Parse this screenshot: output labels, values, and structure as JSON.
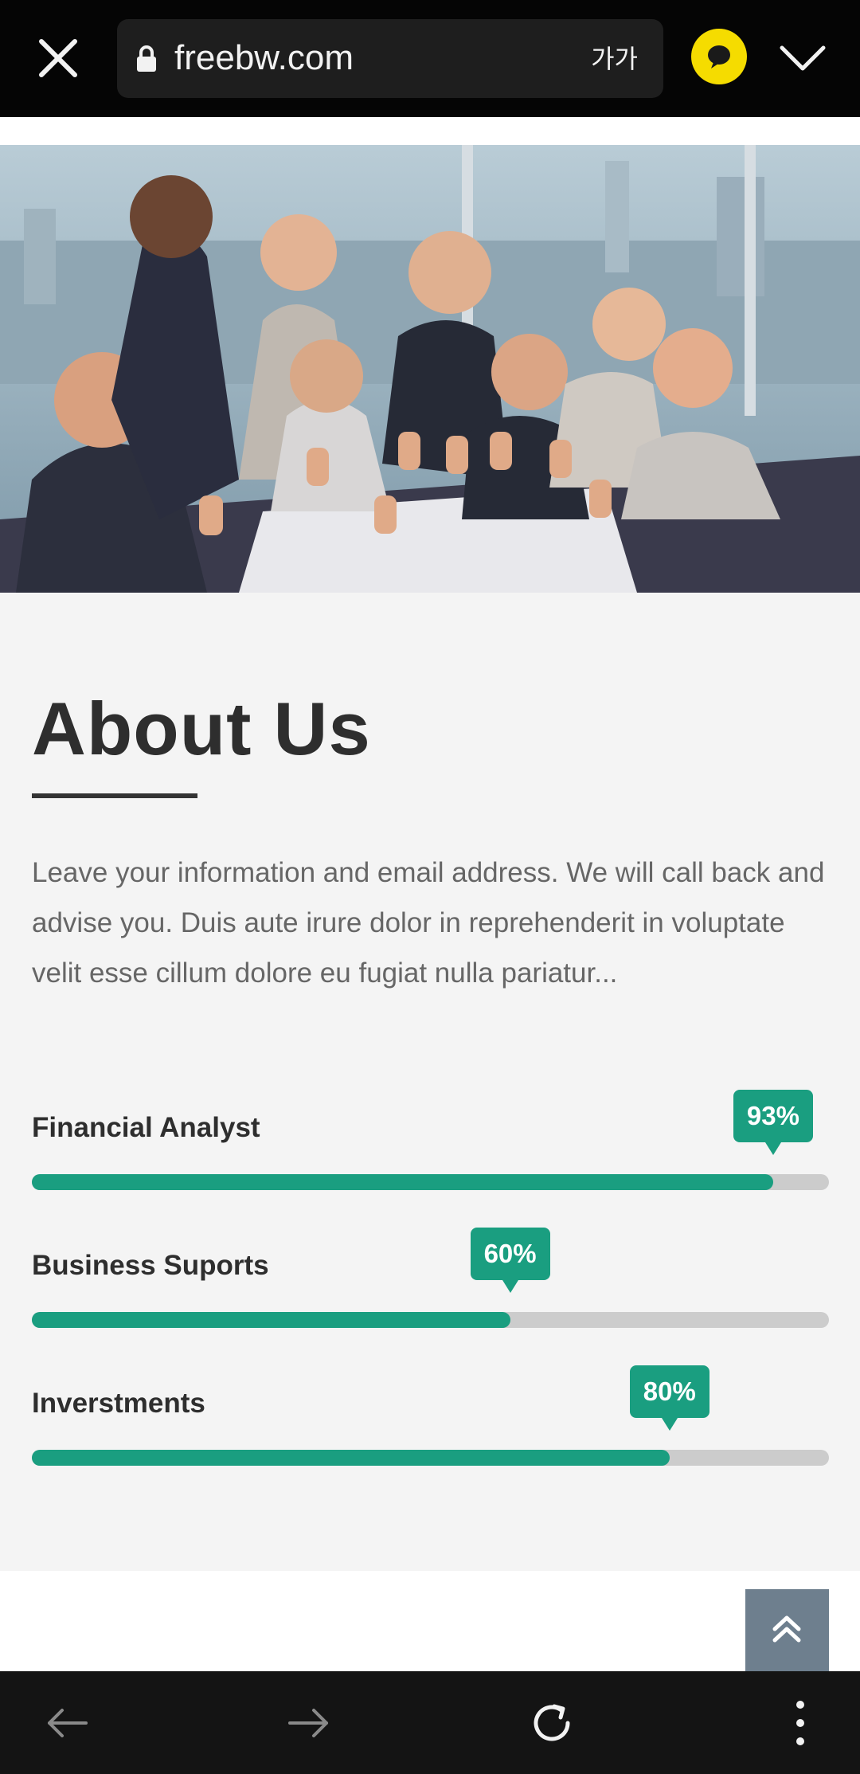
{
  "browser": {
    "url": "freebw.com",
    "text_size_label": "가가"
  },
  "about": {
    "title": "About Us",
    "description": "Leave your information and email address. We will call back and advise you. Duis aute irure dolor in reprehenderit in voluptate velit esse cillum dolore eu fugiat nulla pariatur..."
  },
  "skills": [
    {
      "label": "Financial Analyst",
      "percent_label": "93%",
      "value": 93
    },
    {
      "label": "Business Suports",
      "percent_label": "60%",
      "value": 60
    },
    {
      "label": "Inverstments",
      "percent_label": "80%",
      "value": 80
    }
  ],
  "colors": {
    "accent": "#1a9e80",
    "track": "#cccccc",
    "scroll_button": "#6e7f8e"
  },
  "icons": [
    "close-icon",
    "lock-icon",
    "kakao-chat-icon",
    "chevron-down-icon",
    "double-chevron-up-icon",
    "back-arrow-icon",
    "forward-arrow-icon",
    "reload-icon",
    "more-vertical-icon"
  ]
}
